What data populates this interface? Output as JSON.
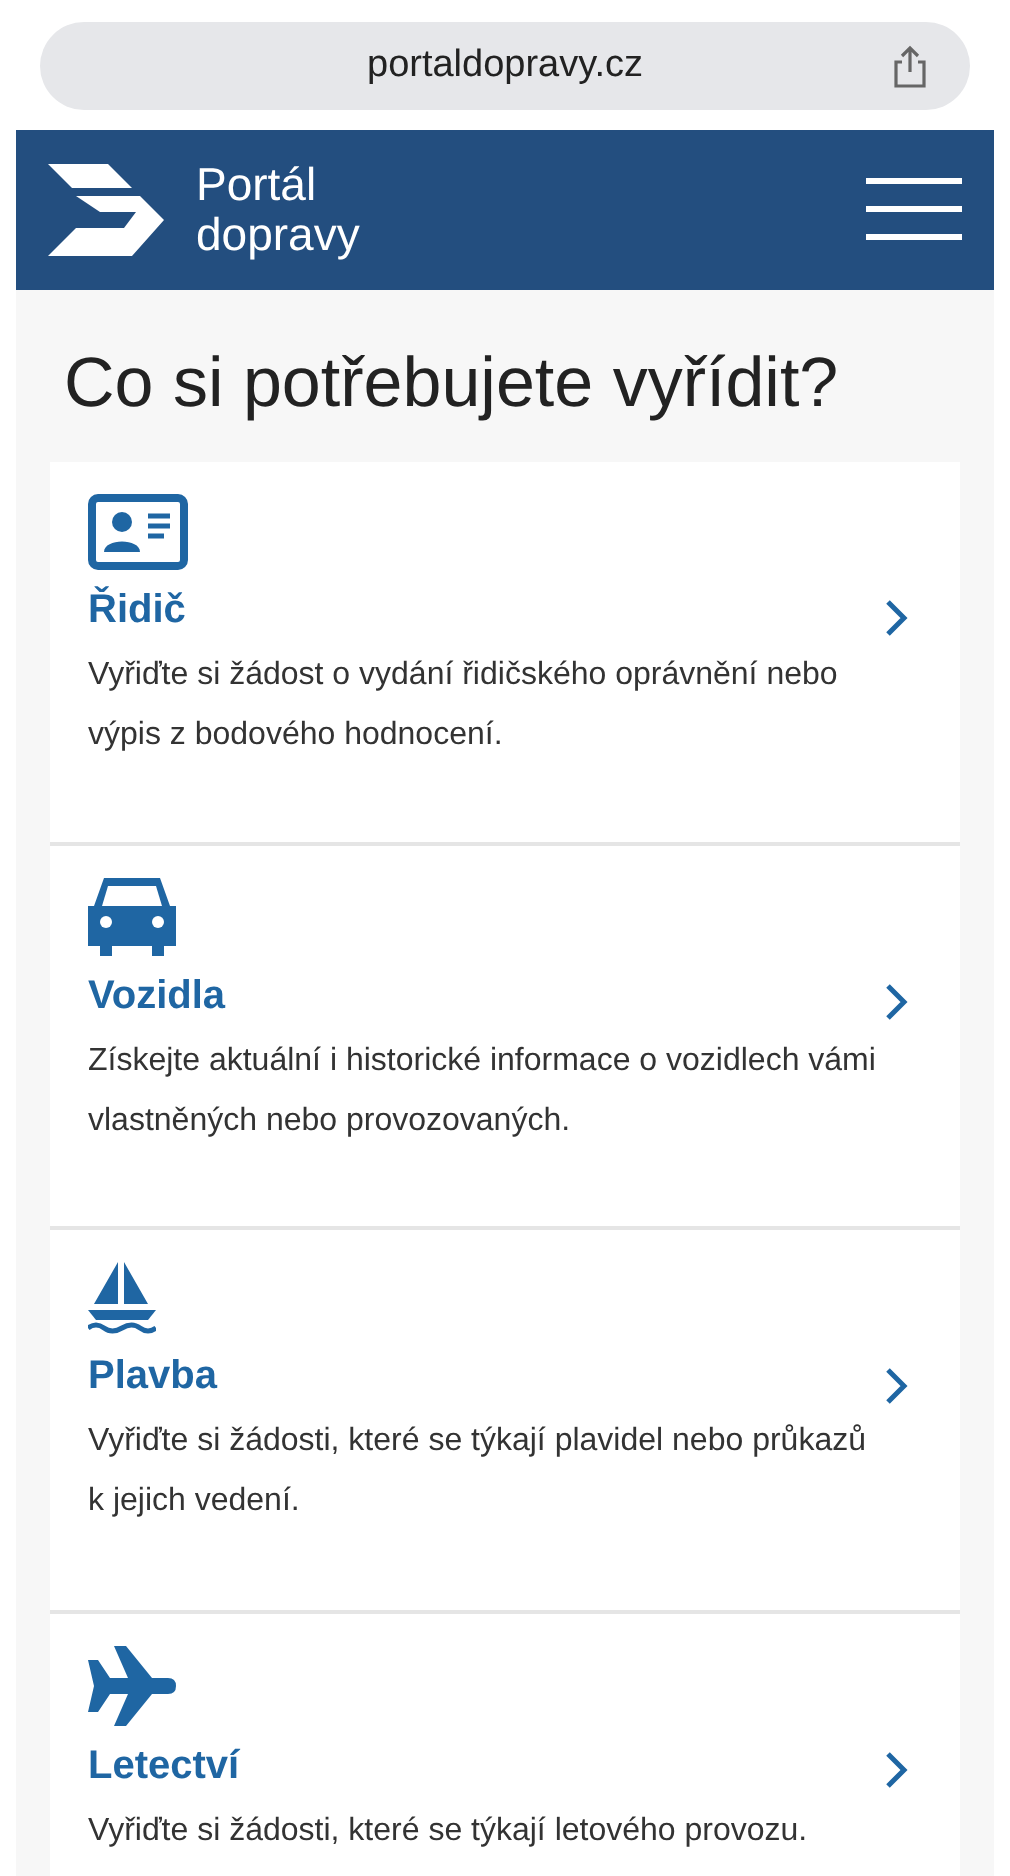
{
  "browser": {
    "url": "portaldopravy.cz"
  },
  "header": {
    "logo_line_1": "Portál",
    "logo_line_2": "dopravy"
  },
  "heading": "Co si potřebujete vyřídit?",
  "cards": [
    {
      "kind": "id-card",
      "title": "Řidič",
      "description": "Vyřiďte si žádost o vydání řidičského oprávnění nebo výpis z bodového hodnocení."
    },
    {
      "kind": "car",
      "title": "Vozidla",
      "description": "Získejte aktuální i historické informace o vozidlech vámi vlastněných nebo provozovaných."
    },
    {
      "kind": "boat",
      "title": "Plavba",
      "description": "Vyřiďte si žádosti, které se týkají plavidel nebo průkazů k jejich vedení."
    },
    {
      "kind": "plane",
      "title": "Letectví",
      "description": "Vyřiďte si žádosti, které se týkají letového provozu."
    }
  ]
}
